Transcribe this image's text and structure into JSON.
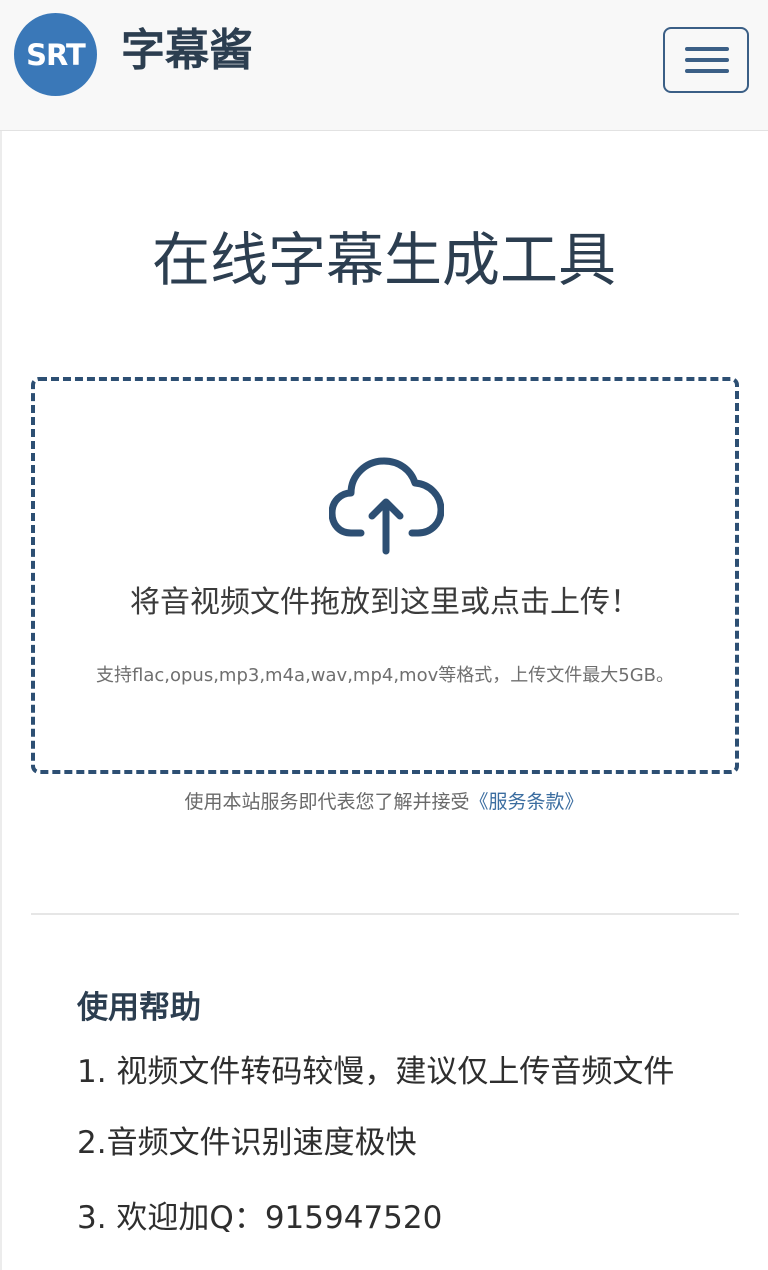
{
  "header": {
    "logo_text": "SRT",
    "brand": "字幕酱",
    "menu_icon": "hamburger-menu-icon"
  },
  "main": {
    "title": "在线字幕生成工具",
    "upload": {
      "icon": "cloud-upload-icon",
      "prompt": "将音视频文件拖放到这里或点击上传！",
      "hint": "支持flac,opus,mp3,m4a,wav,mp4,mov等格式，上传文件最大5GB。"
    },
    "terms": {
      "text": "使用本站服务即代表您了解并接受",
      "link": "《服务条款》"
    }
  },
  "help": {
    "title": "使用帮助",
    "items": [
      "1. 视频文件转码较慢，建议仅上传音频文件",
      "2.音频文件识别速度极快",
      "3. 欢迎加Q：915947520"
    ]
  },
  "colors": {
    "logo_bg": "#3a78b8",
    "accent": "#2d4f73",
    "link": "#3b6da0"
  }
}
